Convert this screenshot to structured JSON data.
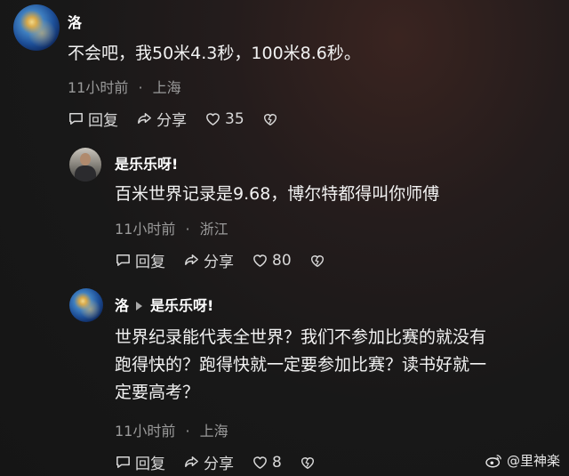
{
  "comments": [
    {
      "user": "洛",
      "text": "不会吧，我50米4.3秒，100米8.6秒。",
      "time": "11小时前",
      "location": "上海",
      "reply_label": "回复",
      "share_label": "分享",
      "likes": "35",
      "avatar_icon": "globe-avatar-icon"
    },
    {
      "user": "是乐乐呀!",
      "text": "百米世界记录是9.68，博尔特都得叫你师傅",
      "time": "11小时前",
      "location": "浙江",
      "reply_label": "回复",
      "share_label": "分享",
      "likes": "80",
      "avatar_icon": "person-avatar-icon"
    },
    {
      "user": "洛",
      "reply_to": "是乐乐呀!",
      "text_lines": [
        "世界纪录能代表全世界？我们不参加比赛的就没有",
        "跑得快的？跑得快就一定要参加比赛？读书好就一",
        "定要高考？"
      ],
      "time": "11小时前",
      "location": "上海",
      "reply_label": "回复",
      "share_label": "分享",
      "likes": "8",
      "avatar_icon": "globe-avatar-icon"
    }
  ],
  "meta_separator": "·",
  "watermark": "@里神楽",
  "colors": {
    "text": "#f2f2f2",
    "meta": "#9a9a9a",
    "actions": "#d8d8d8"
  }
}
